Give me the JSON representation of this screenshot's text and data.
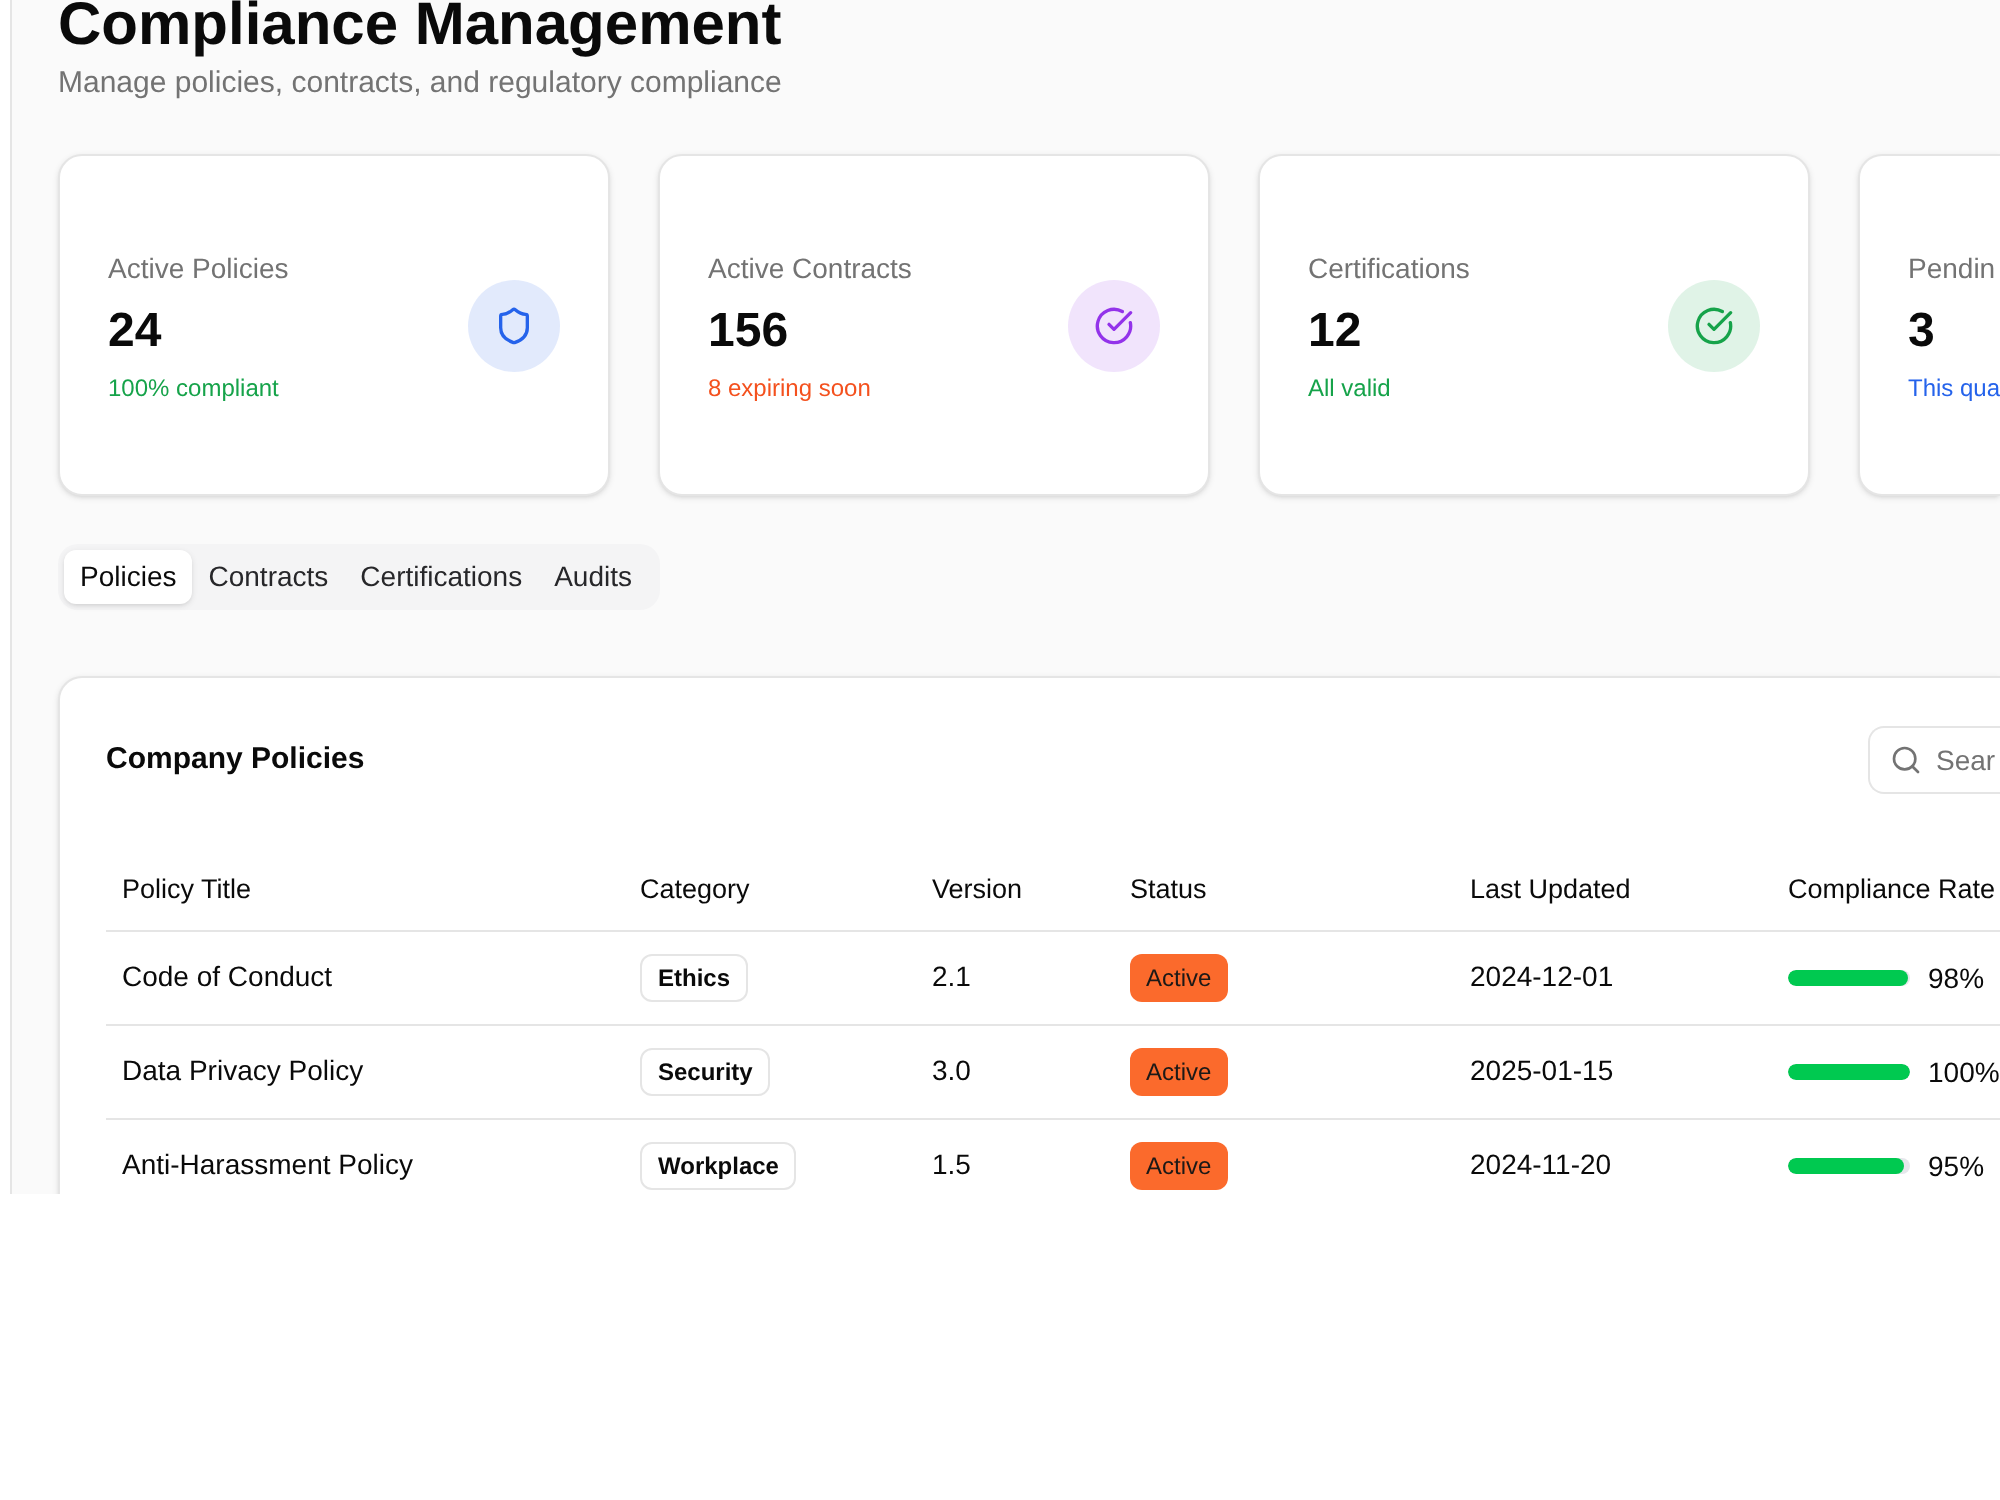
{
  "page": {
    "title": "Compliance Management",
    "subtitle": "Manage policies, contracts, and regulatory compliance"
  },
  "stats": [
    {
      "label": "Active Policies",
      "value": "24",
      "note": {
        "text": "100% compliant",
        "color": "#16a34a"
      },
      "icon": {
        "kind": "shield",
        "color": "#2563eb"
      }
    },
    {
      "label": "Active Contracts",
      "value": "156",
      "note": {
        "text": "8 expiring soon",
        "color": "#f4511e"
      },
      "icon": {
        "kind": "check",
        "color": "#9333ea"
      }
    },
    {
      "label": "Certifications",
      "value": "12",
      "note": {
        "text": "All valid",
        "color": "#16a34a"
      },
      "icon": {
        "kind": "check",
        "color": "#16a34a"
      }
    },
    {
      "label": "Pendin",
      "value": "3",
      "note": {
        "text": "This qua",
        "color": "#2563eb"
      }
    }
  ],
  "tabs": [
    {
      "label": "Policies",
      "selected": true
    },
    {
      "label": "Contracts",
      "selected": false
    },
    {
      "label": "Certifications",
      "selected": false
    },
    {
      "label": "Audits",
      "selected": false
    }
  ],
  "policies": {
    "title": "Company Policies",
    "search": {
      "placeholder": "Sear"
    },
    "columns": [
      "Policy Title",
      "Category",
      "Version",
      "Status",
      "Last Updated",
      "Compliance Rate"
    ],
    "rows": [
      {
        "title": "Code of Conduct",
        "category": "Ethics",
        "version": "2.1",
        "status": "Active",
        "updated": "2024-12-01",
        "compliance": {
          "level": 0.98,
          "reading": "98%"
        }
      },
      {
        "title": "Data Privacy Policy",
        "category": "Security",
        "version": "3.0",
        "status": "Active",
        "updated": "2025-01-15",
        "compliance": {
          "level": 1,
          "reading": "100%"
        }
      },
      {
        "title": "Anti-Harassment Policy",
        "category": "Workplace",
        "version": "1.5",
        "status": "Active",
        "updated": "2024-11-20",
        "compliance": {
          "level": 0.95,
          "reading": "95%"
        }
      }
    ]
  }
}
